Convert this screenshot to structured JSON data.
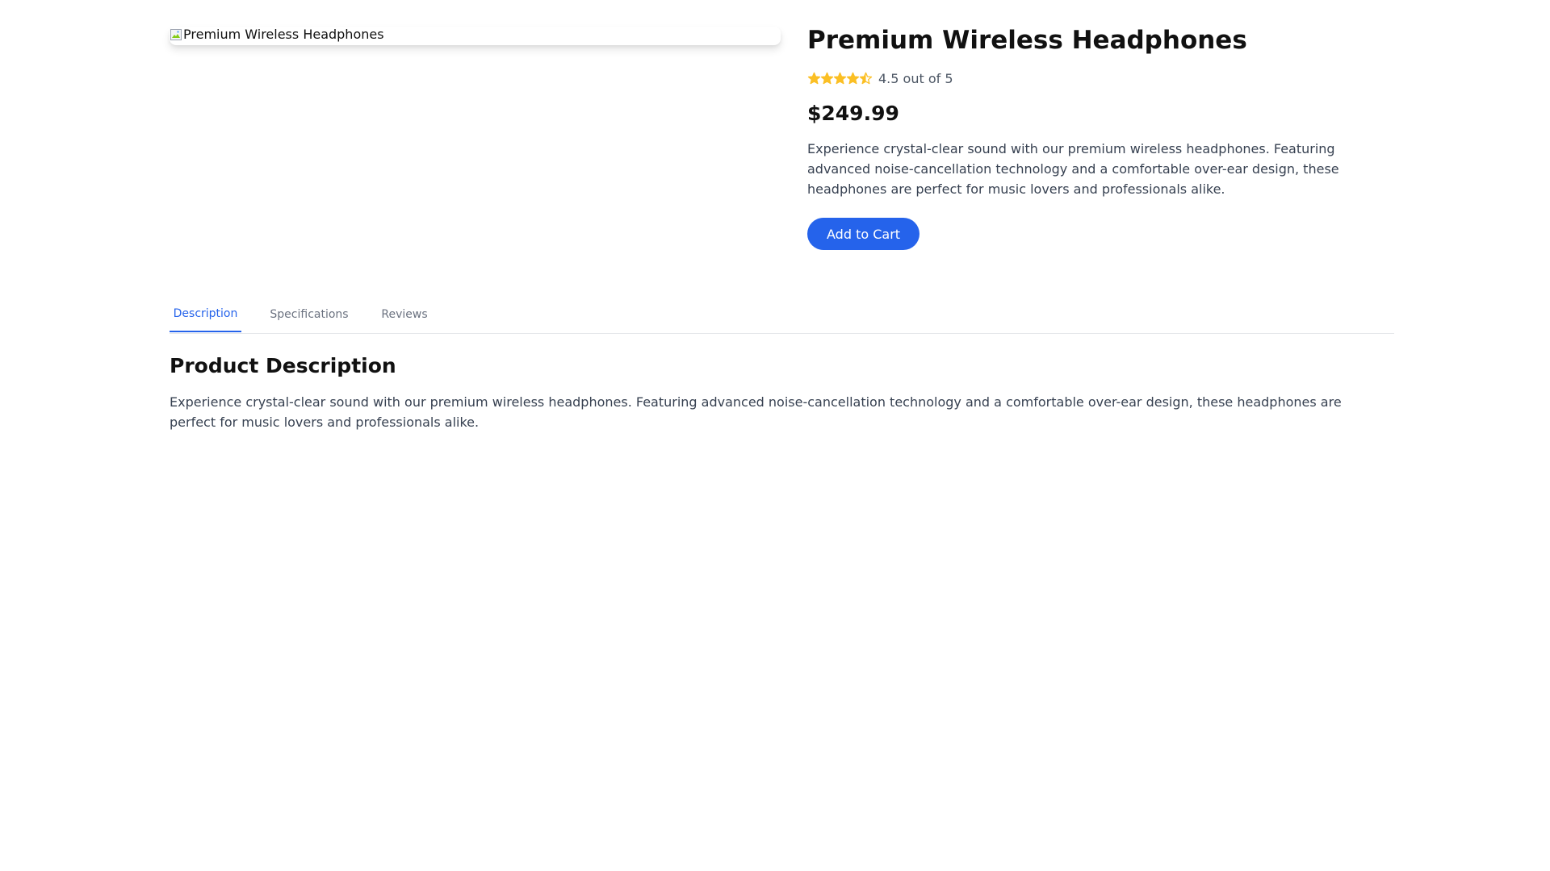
{
  "product": {
    "image_alt": "Premium Wireless Headphones",
    "title": "Premium Wireless Headphones",
    "rating_value": 4.5,
    "rating_max": 5,
    "rating_text": "4.5 out of 5",
    "price": "$249.99",
    "description": "Experience crystal-clear sound with our premium wireless headphones. Featuring advanced noise-cancellation technology and a comfortable over-ear design, these headphones are perfect for music lovers and professionals alike.",
    "add_to_cart_label": "Add to Cart"
  },
  "tabs": [
    {
      "label": "Description",
      "active": true
    },
    {
      "label": "Specifications",
      "active": false
    },
    {
      "label": "Reviews",
      "active": false
    }
  ],
  "panel": {
    "title": "Product Description",
    "text": "Experience crystal-clear sound with our premium wireless headphones. Featuring advanced noise-cancellation technology and a comfortable over-ear design, these headphones are perfect for music lovers and professionals alike."
  },
  "colors": {
    "accent": "#2563eb",
    "star": "#fbbf24",
    "muted_text": "#6b7280"
  },
  "icons": {
    "image": "broken-image-icon",
    "star_full": "star-icon",
    "star_half": "star-half-icon"
  }
}
